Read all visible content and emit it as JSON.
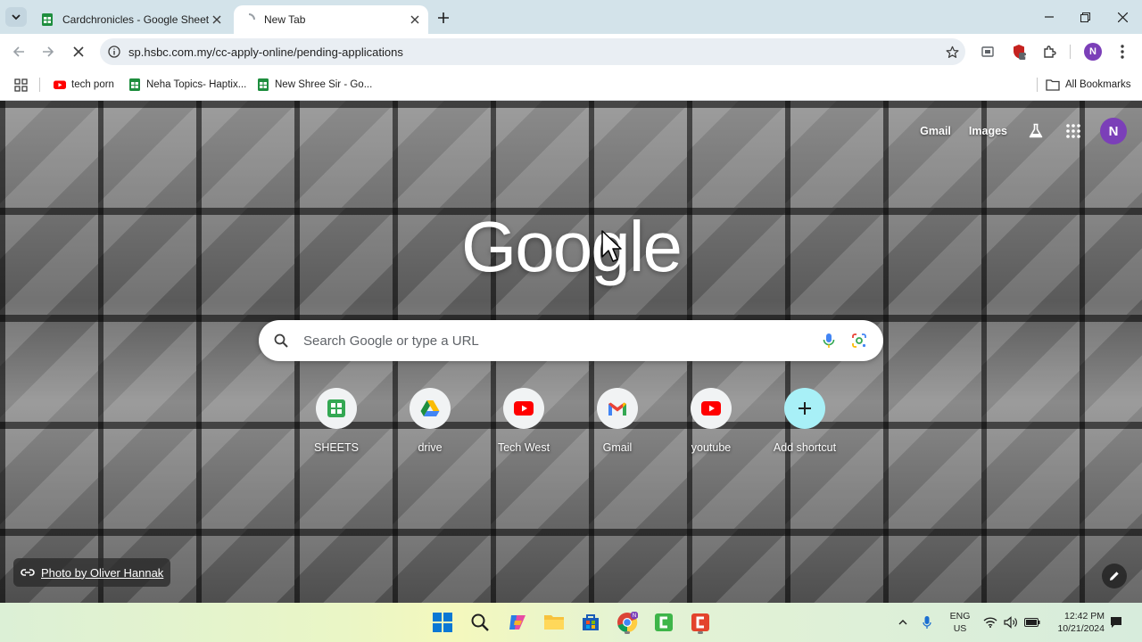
{
  "tabs": [
    {
      "title": "Cardchronicles - Google Sheets",
      "icon": "sheets-icon"
    },
    {
      "title": "New Tab",
      "icon": "loading-icon",
      "active": true
    }
  ],
  "toolbar": {
    "url": "sp.hsbc.com.my/cc-apply-online/pending-applications",
    "profile_initial": "N",
    "extension_badge": "1"
  },
  "bookmarks": {
    "items": [
      {
        "label": "tech porn",
        "icon": "youtube-icon"
      },
      {
        "label": "Neha Topics- Haptix...",
        "icon": "sheets-icon"
      },
      {
        "label": "New Shree Sir - Go...",
        "icon": "sheets-icon"
      }
    ],
    "all_label": "All Bookmarks"
  },
  "ntp": {
    "links": {
      "gmail": "Gmail",
      "images": "Images"
    },
    "avatar_initial": "N",
    "logo": "Google",
    "search_placeholder": "Search Google or type a URL",
    "shortcuts": [
      {
        "label": "SHEETS",
        "icon": "sheets-icon"
      },
      {
        "label": "drive",
        "icon": "drive-icon"
      },
      {
        "label": "Tech West",
        "icon": "youtube-icon"
      },
      {
        "label": "Gmail",
        "icon": "gmail-icon"
      },
      {
        "label": "youtube",
        "icon": "youtube-icon"
      },
      {
        "label": "Add shortcut",
        "icon": "plus-icon"
      }
    ],
    "photo_credit": "Photo by Oliver Hannak"
  },
  "taskbar": {
    "lang_line1": "ENG",
    "lang_line2": "US",
    "time": "12:42 PM",
    "date": "10/21/2024"
  },
  "colors": {
    "profile": "#7b3fb8",
    "sheets_green": "#1e8e3e",
    "youtube_red": "#ff0000",
    "add_shortcut_bg": "#a8f0f7"
  }
}
